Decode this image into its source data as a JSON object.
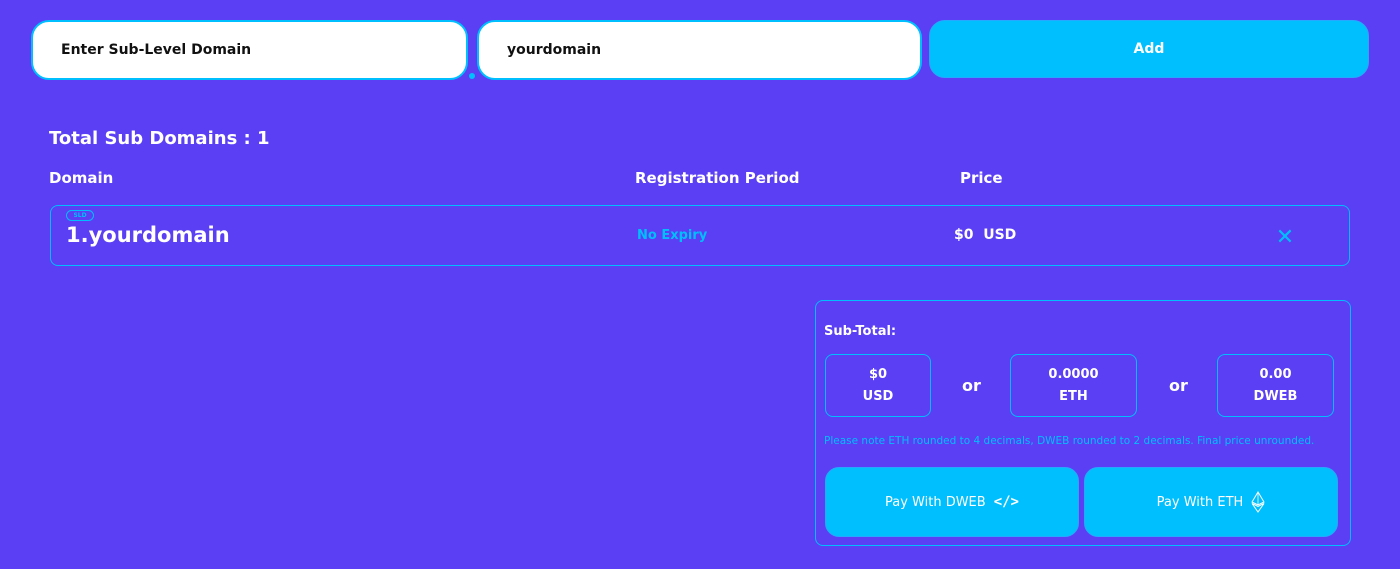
{
  "form": {
    "subdomain_placeholder": "Enter Sub-Level Domain",
    "domain_value": "yourdomain",
    "add_label": "Add"
  },
  "summary_header": {
    "total_label": "Total Sub Domains : 1"
  },
  "table": {
    "columns": [
      "Domain",
      "Registration Period",
      "Price"
    ],
    "rows": [
      {
        "badge": "SLD",
        "domain": "1.yourdomain",
        "period": "No Expiry",
        "price": "$0",
        "currency": "USD",
        "remove_icon": "close-icon"
      }
    ]
  },
  "checkout": {
    "subtotal_label": "Sub-Total:",
    "amounts": [
      {
        "value": "$0",
        "unit": "USD"
      },
      {
        "value": "0.0000",
        "unit": "ETH"
      },
      {
        "value": "0.00",
        "unit": "DWEB"
      }
    ],
    "or_label": "or",
    "note": "Please note ETH rounded to 4 decimals, DWEB rounded to 2 decimals. Final price unrounded.",
    "pay_dweb_label": "Pay With DWEB",
    "pay_eth_label": "Pay With ETH",
    "pay_dweb_icon": "code-icon",
    "pay_eth_icon": "ethereum-icon"
  },
  "colors": {
    "background": "#5b3ff4",
    "accent": "#00bfff",
    "text": "#ffffff"
  }
}
